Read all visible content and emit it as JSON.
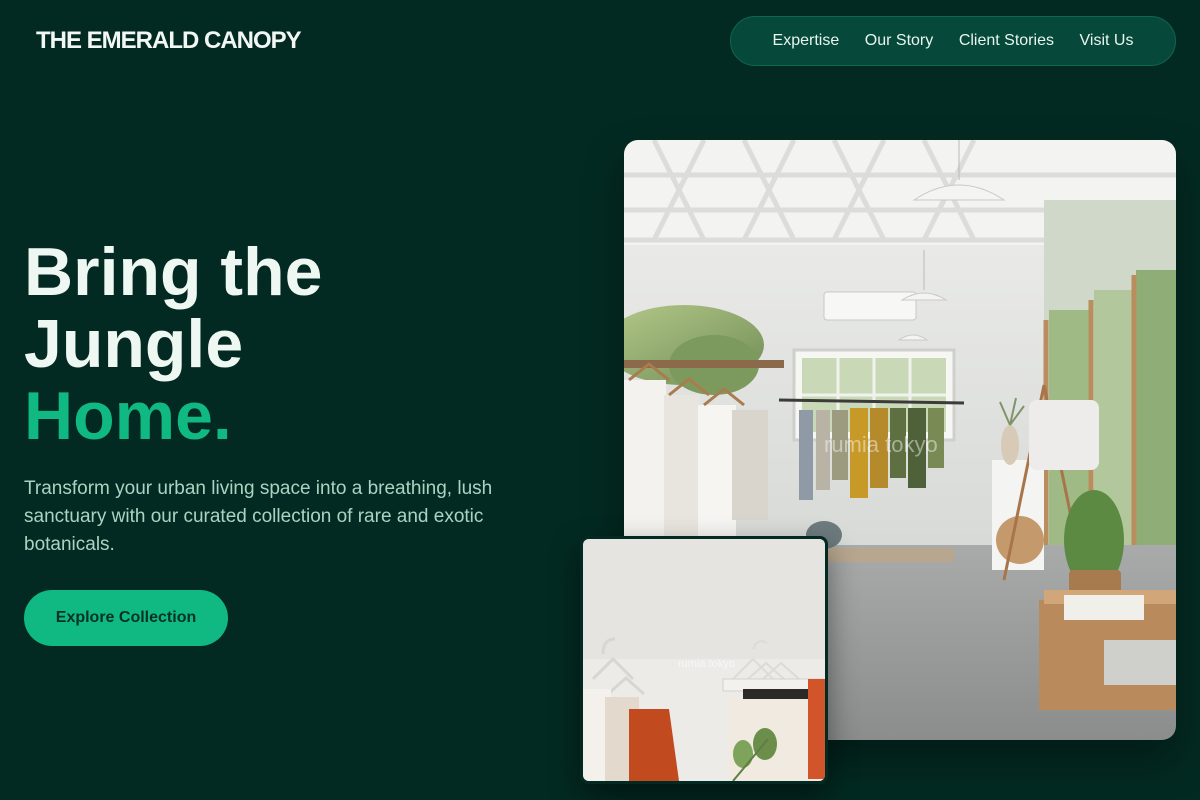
{
  "brand": {
    "name": "THE EMERALD CANOPY"
  },
  "nav": {
    "items": [
      {
        "label": "Expertise"
      },
      {
        "label": "Our Story"
      },
      {
        "label": "Client Stories"
      },
      {
        "label": "Visit Us"
      }
    ]
  },
  "hero": {
    "title_line1": "Bring the",
    "title_line2": "Jungle",
    "title_accent": "Home.",
    "subtitle": "Transform your urban living space into a breathing, lush sanctuary with our curated collection of rare and exotic botanicals.",
    "cta_label": "Explore Collection"
  },
  "images": {
    "main_watermark": "rumia tokyo",
    "small_watermark": "rumia tokyo"
  },
  "colors": {
    "background": "#032a22",
    "accent": "#10b981",
    "nav_bg": "#06493a",
    "text_light": "#eef7f1",
    "text_muted": "#a9d4c1"
  }
}
